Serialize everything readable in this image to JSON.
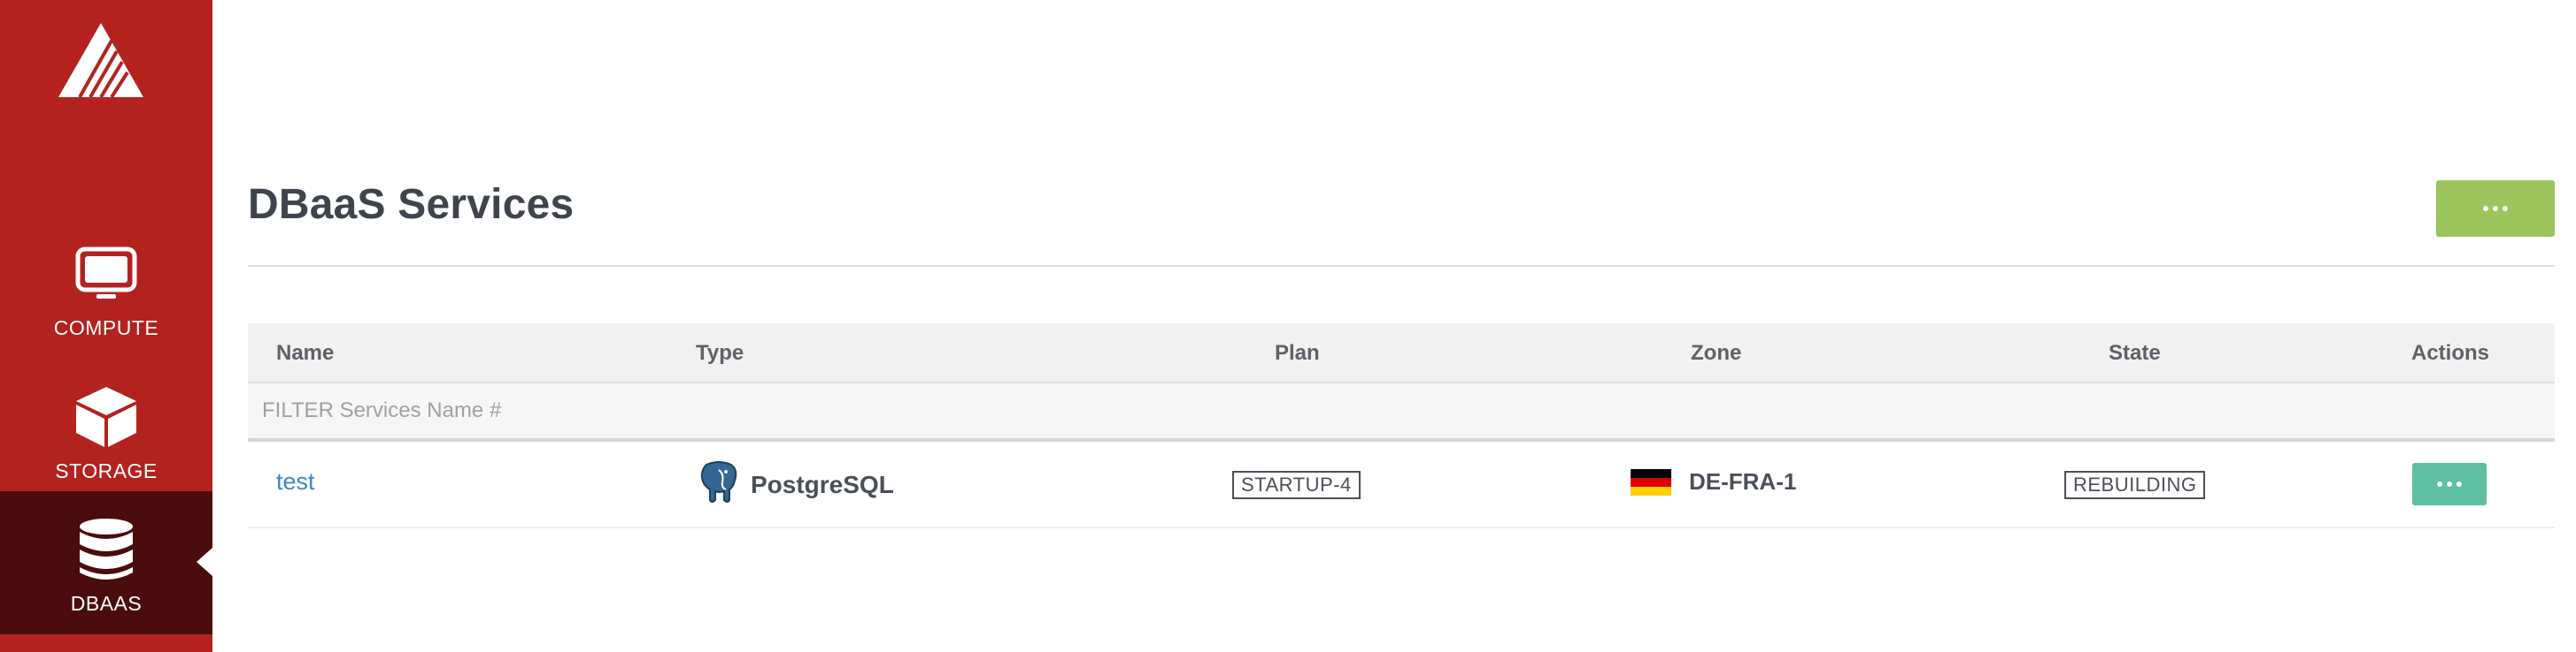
{
  "sidebar": {
    "logo_icon": "exoscale-logo-icon",
    "items": [
      {
        "label": "COMPUTE",
        "icon": "monitor-icon",
        "active": false
      },
      {
        "label": "STORAGE",
        "icon": "cube-icon",
        "active": false
      },
      {
        "label": "DBAAS",
        "icon": "database-icon",
        "active": true
      }
    ]
  },
  "header": {
    "title": "DBaaS Services",
    "more_button_icon": "more-dots-icon"
  },
  "table": {
    "columns": [
      "Name",
      "Type",
      "Plan",
      "Zone",
      "State",
      "Actions"
    ],
    "filter_placeholder": "FILTER Services Name #",
    "filter_value": "",
    "rows": [
      {
        "name": "test",
        "type": "PostgreSQL",
        "type_icon": "postgresql-elephant-icon",
        "plan": "STARTUP-4",
        "zone": "DE-FRA-1",
        "zone_flag": "germany-flag-icon",
        "state": "REBUILDING",
        "actions_icon": "more-dots-icon"
      }
    ]
  },
  "colors": {
    "sidebar_bg": "#b3221f",
    "sidebar_active_bg": "#4a0c0c",
    "header_button": "#9cc45d",
    "row_action_button": "#5ebfa3",
    "link": "#3f86c8"
  }
}
